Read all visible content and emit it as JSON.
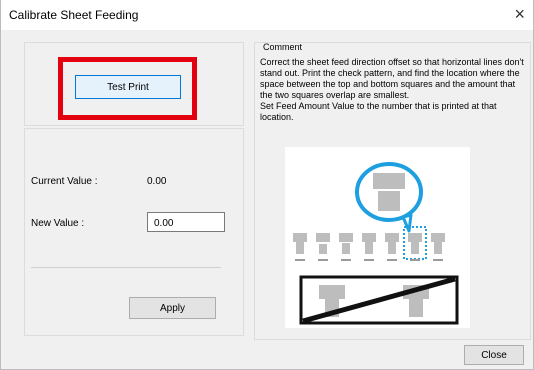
{
  "window": {
    "title": "Calibrate Sheet Feeding",
    "close_symbol": "×"
  },
  "left": {
    "test_print_label": "Test Print",
    "current_value_label": "Current Value :",
    "current_value": "0.00",
    "new_value_label": "New Value :",
    "new_value": "0.00",
    "apply_label": "Apply"
  },
  "comment": {
    "title": "Comment",
    "text": "Correct the sheet feed direction offset so that horizontal lines don't stand out. Print the check pattern, and find the location where the space between the top and bottom squares and the amount that the two squares overlap are smallest.\nSet Feed Amount Value to the number that is printed at that location."
  },
  "footer": {
    "close_label": "Close"
  },
  "colors": {
    "highlight": "#e3000f",
    "callout": "#1ea0e0",
    "pattern_gray": "#bdbdbd"
  }
}
